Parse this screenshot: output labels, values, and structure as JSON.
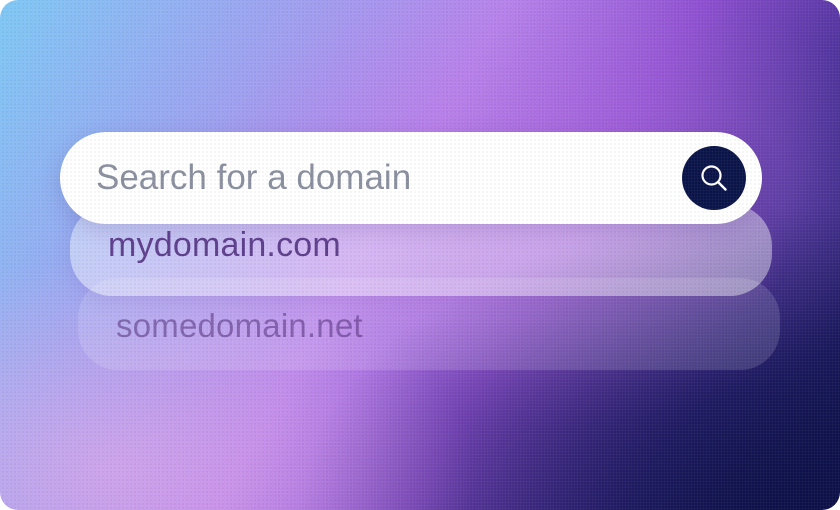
{
  "search": {
    "placeholder": "Search for a domain",
    "value": "",
    "button_icon": "search-icon"
  },
  "suggestions": [
    {
      "label": "mydomain.com"
    },
    {
      "label": "somedomain.net"
    }
  ],
  "colors": {
    "button_bg": "#0b1448",
    "placeholder_text": "#8a8f9f",
    "primary_suggestion_text": "#5e3f8c",
    "secondary_suggestion_text": "rgba(80,45,120,0.55)"
  }
}
